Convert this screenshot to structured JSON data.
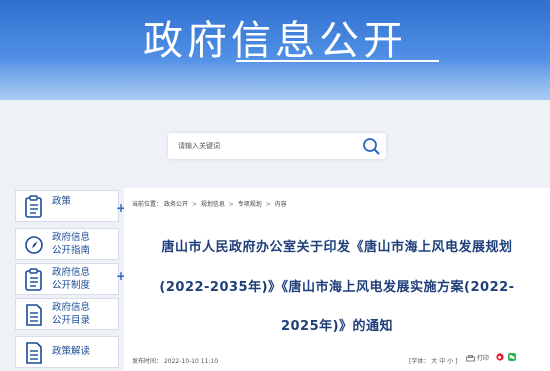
{
  "banner": {
    "title": "政府信息公开"
  },
  "search": {
    "placeholder": "请输入关键词"
  },
  "sidebar": {
    "items": [
      {
        "label_line1": "政策",
        "label_line2": "",
        "has_plus": true,
        "icon": "document-list-icon"
      },
      {
        "label_line1": "政府信息",
        "label_line2": "公开指南",
        "has_plus": false,
        "icon": "compass-icon"
      },
      {
        "label_line1": "政府信息",
        "label_line2": "公开制度",
        "has_plus": true,
        "icon": "document-list-icon"
      },
      {
        "label_line1": "政府信息",
        "label_line2": "公开目录",
        "has_plus": false,
        "icon": "document-lines-icon"
      },
      {
        "label_line1": "政策解读",
        "label_line2": "",
        "has_plus": false,
        "icon": "document-lines-icon"
      }
    ],
    "plus_symbol": "+"
  },
  "breadcrumb": {
    "prefix": "当前位置：",
    "items": [
      "政务公开",
      "规划信息",
      "专项规划",
      "内容"
    ],
    "separator": ">"
  },
  "document": {
    "title_line1": "唐山市人民政府办公室关于印发《唐山市海上风电发展规划",
    "title_line2": "(2022-2035年)》《唐山市海上风电发展实施方案(2022-",
    "title_line3": "2025年)》的通知",
    "publish_label": "发布时间：",
    "publish_time": "2022-10-10 11:10",
    "font_label": "[字体：",
    "font_large": "大",
    "font_medium": "中",
    "font_small": "小",
    "font_close": "]",
    "print_label": "打印"
  },
  "colors": {
    "banner": "#3a7bd8",
    "link": "#1a4b95",
    "title": "#1f3f7a",
    "share_wechat": "#2bb24c",
    "share_weibo": "#e6162d"
  }
}
